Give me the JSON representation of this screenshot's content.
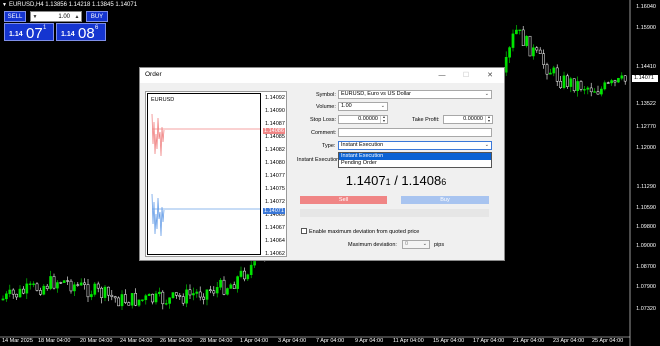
{
  "window": {
    "title": "EURUSD,H4  1.13856 1.14218 1.13845 1.14071"
  },
  "trade_panel": {
    "sell_label": "SELL",
    "buy_label": "BUY",
    "lot": "1.00",
    "bid": {
      "big_prefix": "1.14",
      "big": "07",
      "sup": "1"
    },
    "ask": {
      "big_prefix": "1.14",
      "big": "08",
      "sup": "6"
    }
  },
  "price_axis": {
    "labels": [
      "1.16040",
      "1.15900",
      "1.14410",
      "1.13522",
      "1.12770",
      "1.12000",
      "1.11290",
      "1.10590",
      "1.09800",
      "1.09000",
      "1.08700",
      "1.07900",
      "1.07320"
    ],
    "current": "1.14071"
  },
  "time_axis": [
    "14 Mar 2025",
    "18 Mar 04:00",
    "20 Mar 04:00",
    "24 Mar 04:00",
    "26 Mar 04:00",
    "28 Mar 04:00",
    "1 Apr 04:00",
    "3 Apr 04:00",
    "7 Apr 04:00",
    "9 Apr 04:00",
    "11 Apr 04:00",
    "15 Apr 04:00",
    "17 Apr 04:00",
    "21 Apr 04:00",
    "23 Apr 04:00",
    "25 Apr 04:00"
  ],
  "dialog": {
    "title": "Order",
    "mini_chart": {
      "symbol": "EURUSD",
      "scale": [
        "1.14092",
        "1.14090",
        "1.14087",
        "1.14085",
        "1.14082",
        "1.14080",
        "1.14077",
        "1.14075",
        "1.14072",
        "1.14069",
        "1.14067",
        "1.14064",
        "1.14062"
      ],
      "ask_tag": "1.14086",
      "bid_tag": "1.14071"
    },
    "symbol_label": "Symbol:",
    "symbol_value": "EURUSD, Euro vs US Dollar",
    "volume_label": "Volume:",
    "volume_value": "1.00",
    "stop_loss_label": "Stop Loss:",
    "stop_loss_value": "0.00000",
    "take_profit_label": "Take Profit:",
    "take_profit_value": "0.00000",
    "comment_label": "Comment:",
    "comment_value": "",
    "type_label": "Type:",
    "type_value": "Instant Execution",
    "type_options": [
      "Instant Execution",
      "Pending Order"
    ],
    "instant_exec_label": "Instant Execution",
    "price_main": "1.1407",
    "price_main_small": "1",
    "price_sep": " / ",
    "price_alt": "1.1408",
    "price_alt_small": "6",
    "sell_label": "Sell",
    "buy_label": "Buy",
    "deviation_check_label": "Enable maximum deviation from quoted price",
    "max_dev_label": "Maximum deviation:",
    "max_dev_value": "0",
    "pips_label": "pips"
  },
  "colors": {
    "up_candle": "#00e600",
    "down_candle": "#ffffff",
    "panel_blue": "#1535d0",
    "sell": "#f08585",
    "buy": "#a8c4f0"
  }
}
